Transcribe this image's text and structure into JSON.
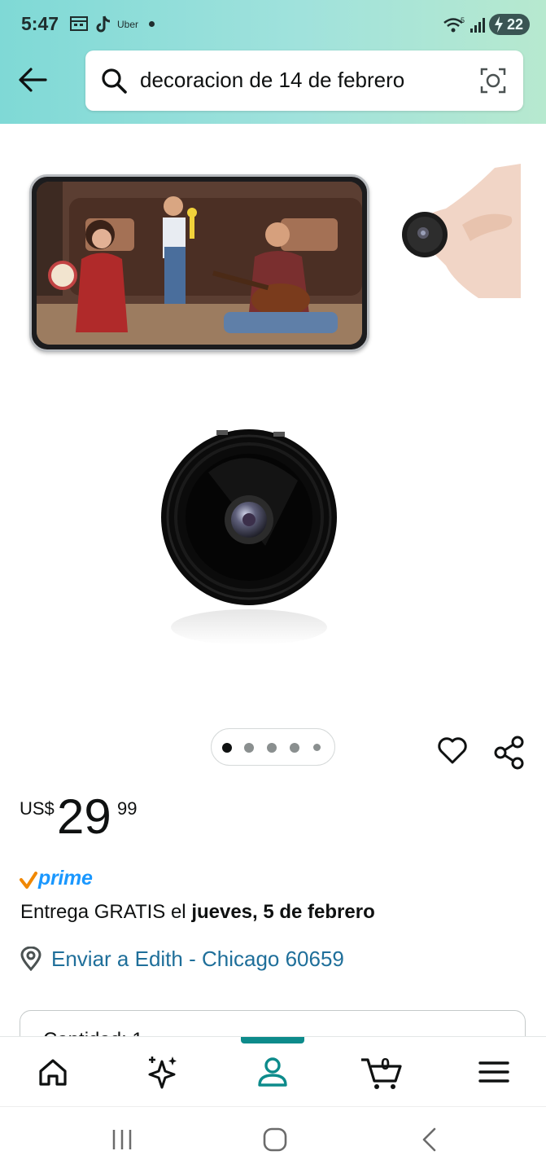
{
  "status_bar": {
    "time": "5:47",
    "app_label": "Uber",
    "signal_label": "5",
    "battery": "22"
  },
  "search": {
    "query": "decoracion de 14 de febrero"
  },
  "gallery": {
    "page_count": 5,
    "active_page": 1
  },
  "price": {
    "currency": "US$",
    "whole": "29",
    "fraction": "99"
  },
  "prime": {
    "label": "prime"
  },
  "delivery": {
    "prefix": "Entrega GRATIS el ",
    "date": "jueves, 5 de febrero"
  },
  "location": {
    "text": "Enviar a Edith - Chicago 60659"
  },
  "quantity": {
    "label": "Cantidad: 1"
  },
  "cart": {
    "count": "0"
  },
  "colors": {
    "accent": "#0d8b8b",
    "prime_blue": "#1a98ff",
    "link": "#1f6f9a",
    "prime_check": "#f08804"
  },
  "icons": [
    "back-arrow-icon",
    "search-icon",
    "camera-lens-icon",
    "heart-icon",
    "share-icon",
    "location-pin-icon",
    "home-icon",
    "sparkle-icon",
    "account-icon",
    "cart-icon",
    "menu-icon",
    "recent-apps-icon",
    "home-circle-icon",
    "back-chevron-icon"
  ]
}
